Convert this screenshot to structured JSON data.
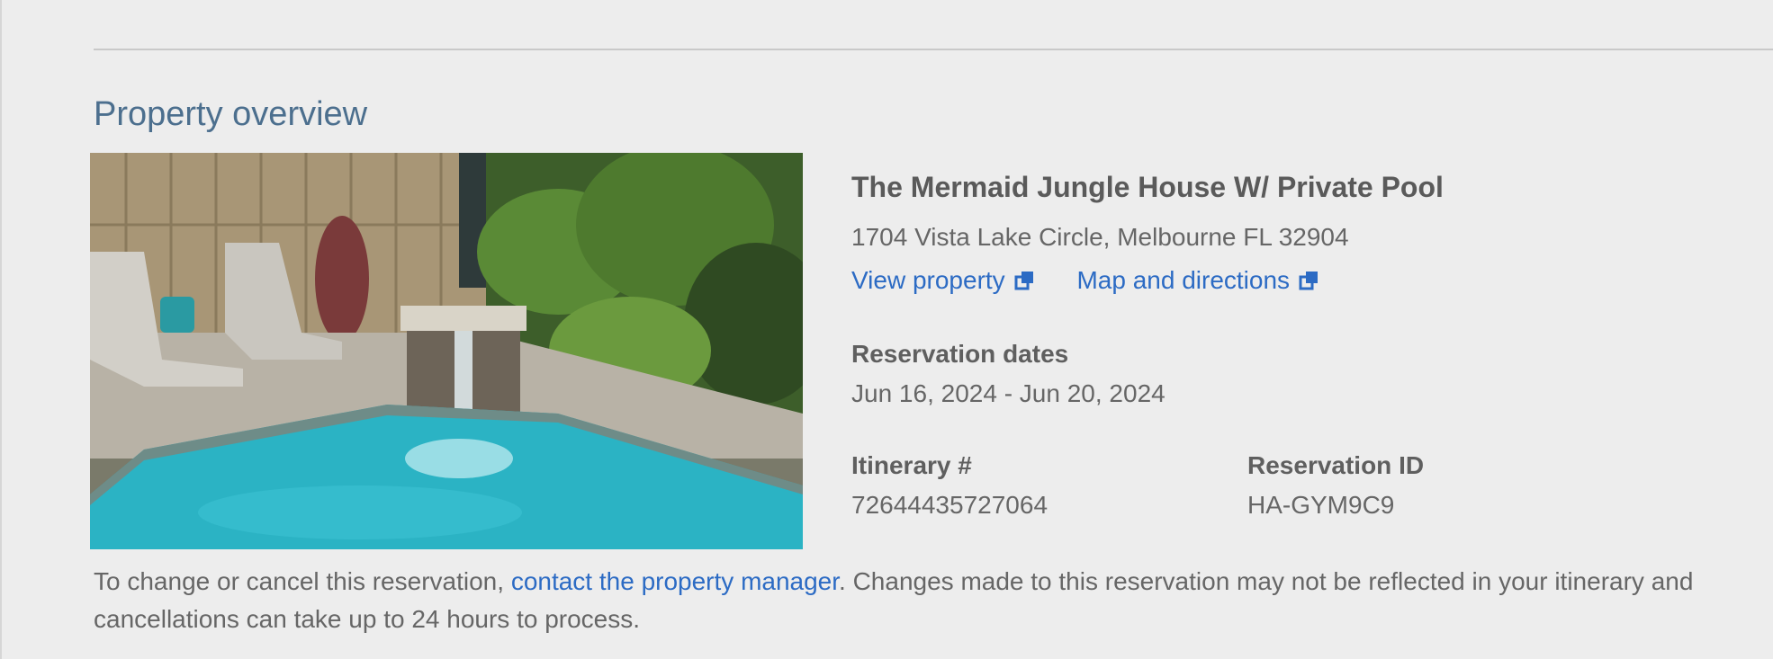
{
  "section_title": "Property overview",
  "property": {
    "name": "The Mermaid Jungle House W/ Private Pool",
    "address": "1704 Vista Lake Circle, Melbourne FL 32904",
    "view_property_label": "View property",
    "map_label": "Map and directions"
  },
  "reservation": {
    "dates_label": "Reservation dates",
    "dates_value": "Jun 16, 2024 - Jun 20, 2024",
    "itinerary_label": "Itinerary #",
    "itinerary_value": "72644435727064",
    "reservation_id_label": "Reservation ID",
    "reservation_id_value": "HA-GYM9C9"
  },
  "note": {
    "before": "To change or cancel this reservation, ",
    "link": "contact the property manager",
    "after": ". Changes made to this reservation may not be reflected in your itinerary and cancellations can take up to 24 hours to process."
  },
  "icons": {
    "external_link": "external-link-icon"
  },
  "colors": {
    "link": "#2c6bc4",
    "section_title": "#4c6f8e",
    "background": "#ededed"
  }
}
